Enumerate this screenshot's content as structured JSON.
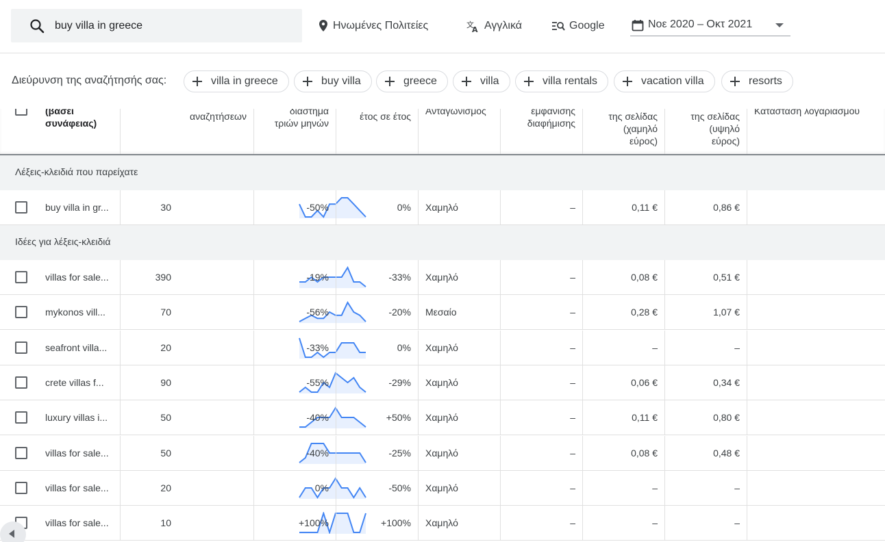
{
  "search": {
    "value": "buy villa in greece"
  },
  "toolbar": {
    "location": "Ηνωμένες Πολιτείες",
    "language": "Αγγλικά",
    "network": "Google",
    "date_range": "Νοε 2020 – Οκτ 2021"
  },
  "broaden": {
    "label": "Διεύρυνση της αναζήτησής σας:",
    "chips": [
      "villa in greece",
      "buy villa",
      "greece",
      "villa",
      "villa rentals",
      "vacation villa",
      "resorts"
    ]
  },
  "columns": {
    "keyword": [
      "(βάσει",
      "συνάφειας)"
    ],
    "searches": [
      "αναζητήσεων"
    ],
    "three_month": [
      "διάστημα",
      "τριών μηνών"
    ],
    "yoy": [
      "έτος σε έτος"
    ],
    "competition": [
      "Ανταγωνισμός"
    ],
    "impression_share": [
      "εμφάνισης",
      "διαφήμισης"
    ],
    "bid_low": [
      "της σελίδας",
      "(χαμηλό",
      "εύρος)"
    ],
    "bid_high": [
      "της σελίδας",
      "(υψηλό",
      "εύρος)"
    ],
    "account_status": [
      "Κατάσταση λογαριασμού"
    ]
  },
  "sections": {
    "provided": "Λέξεις-κλειδιά που παρείχατε",
    "ideas": "Ιδέες για λέξεις-κλειδιά"
  },
  "accent_color": "#4285f4",
  "provided_rows": [
    {
      "keyword": "buy villa in gr...",
      "searches": "30",
      "trend": [
        3,
        1,
        1,
        2,
        1,
        3,
        3,
        4,
        4,
        3,
        2,
        1
      ],
      "three_month": "-50%",
      "yoy": "0%",
      "competition": "Χαμηλό",
      "impression_share": "–",
      "bid_low": "0,11 €",
      "bid_high": "0,86 €"
    }
  ],
  "idea_rows": [
    {
      "keyword": "villas for sale...",
      "searches": "390",
      "trend": [
        2,
        2,
        3,
        2,
        3,
        3,
        3,
        3,
        5,
        2,
        2,
        1
      ],
      "three_month": "-19%",
      "yoy": "-33%",
      "competition": "Χαμηλό",
      "impression_share": "–",
      "bid_low": "0,08 €",
      "bid_high": "0,51 €"
    },
    {
      "keyword": "mykonos vill...",
      "searches": "70",
      "trend": [
        1,
        2,
        3,
        2,
        2,
        4,
        3,
        3,
        7,
        4,
        3,
        1
      ],
      "three_month": "-56%",
      "yoy": "-20%",
      "competition": "Μεσαίο",
      "impression_share": "–",
      "bid_low": "0,28 €",
      "bid_high": "1,07 €"
    },
    {
      "keyword": "seafront villa...",
      "searches": "20",
      "trend": [
        5,
        1,
        1,
        2,
        1,
        2,
        2,
        4,
        4,
        4,
        2,
        2
      ],
      "three_month": "-33%",
      "yoy": "0%",
      "competition": "Χαμηλό",
      "impression_share": "–",
      "bid_low": "–",
      "bid_high": "–"
    },
    {
      "keyword": "crete villas f...",
      "searches": "90",
      "trend": [
        2,
        3,
        2,
        2,
        4,
        3,
        6,
        5,
        4,
        5,
        3,
        2
      ],
      "three_month": "-55%",
      "yoy": "-29%",
      "competition": "Χαμηλό",
      "impression_share": "–",
      "bid_low": "0,06 €",
      "bid_high": "0,34 €"
    },
    {
      "keyword": "luxury villas i...",
      "searches": "50",
      "trend": [
        1,
        1,
        2,
        3,
        3,
        3,
        5,
        3,
        3,
        3,
        2,
        1
      ],
      "three_month": "-40%",
      "yoy": "+50%",
      "competition": "Χαμηλό",
      "impression_share": "–",
      "bid_low": "0,11 €",
      "bid_high": "0,80 €"
    },
    {
      "keyword": "villas for sale...",
      "searches": "50",
      "trend": [
        1,
        2,
        5,
        5,
        5,
        3,
        3,
        3,
        3,
        3,
        3,
        1
      ],
      "three_month": "-40%",
      "yoy": "-25%",
      "competition": "Χαμηλό",
      "impression_share": "–",
      "bid_low": "0,08 €",
      "bid_high": "0,48 €"
    },
    {
      "keyword": "villas for sale...",
      "searches": "20",
      "trend": [
        2,
        3,
        3,
        2,
        3,
        3,
        4,
        3,
        3,
        2,
        3,
        2
      ],
      "three_month": "0%",
      "yoy": "-50%",
      "competition": "Χαμηλό",
      "impression_share": "–",
      "bid_low": "–",
      "bid_high": "–"
    },
    {
      "keyword": "villas for sale...",
      "searches": "10",
      "trend": [
        1,
        1,
        1,
        1,
        3,
        1,
        3,
        3,
        3,
        1,
        1,
        3
      ],
      "three_month": "+100%",
      "yoy": "+100%",
      "competition": "Χαμηλό",
      "impression_share": "–",
      "bid_low": "–",
      "bid_high": "–"
    }
  ]
}
